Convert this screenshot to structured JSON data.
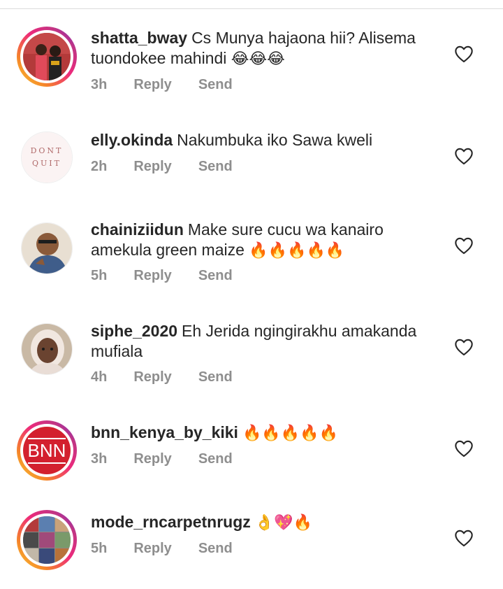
{
  "comments": [
    {
      "username": "shatta_bway",
      "text": "Cs Munya hajaona hii? Alisema tuondokee mahindi",
      "emojis": "😂😂😂",
      "time": "3h",
      "reply": "Reply",
      "send": "Send"
    },
    {
      "username": "elly.okinda",
      "text": "Nakumbuka iko Sawa kweli",
      "emojis": "",
      "time": "2h",
      "reply": "Reply",
      "send": "Send",
      "avatar_text_1": "DONT",
      "avatar_text_2": "QUIT"
    },
    {
      "username": "chainiziidun",
      "text": "Make sure cucu wa kanairo amekula green maize",
      "emojis": "🔥🔥🔥🔥🔥",
      "time": "5h",
      "reply": "Reply",
      "send": "Send"
    },
    {
      "username": "siphe_2020",
      "text": "Eh Jerida ngingirakhu amakanda mufiala",
      "emojis": "",
      "time": "4h",
      "reply": "Reply",
      "send": "Send"
    },
    {
      "username": "bnn_kenya_by_kiki",
      "text": "",
      "emojis": "🔥🔥🔥🔥🔥",
      "time": "3h",
      "reply": "Reply",
      "send": "Send",
      "avatar_text": "BNN"
    },
    {
      "username": "mode_rncarpetnrugz",
      "text": "",
      "emojis": "👌💖🔥",
      "time": "5h",
      "reply": "Reply",
      "send": "Send"
    }
  ],
  "colors": {
    "text": "#262626",
    "meta": "#8e8e8e",
    "story_ring": [
      "#f9ce34",
      "#ee2a7b",
      "#6228d7"
    ],
    "bnn_red": "#d3202e"
  },
  "icons": {
    "like": "heart-outline-icon"
  }
}
